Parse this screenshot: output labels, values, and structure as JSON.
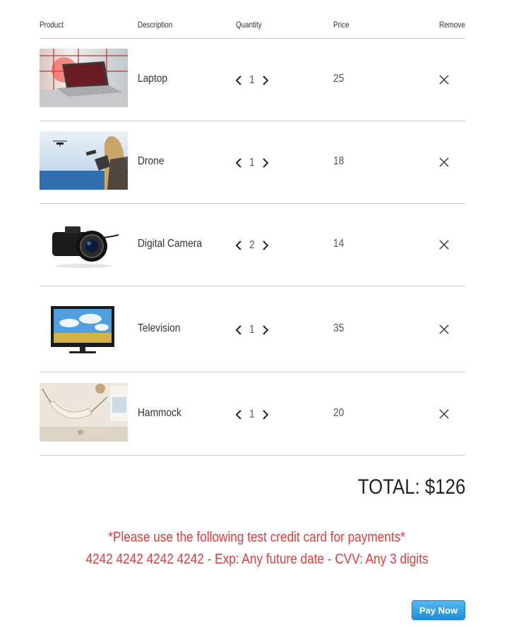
{
  "header": {
    "product": "Product",
    "description": "Description",
    "quantity": "Quantity",
    "price": "Price",
    "remove": "Remove"
  },
  "items": [
    {
      "name": "Laptop",
      "quantity": "1",
      "price": "25",
      "image": "laptop-photo"
    },
    {
      "name": "Drone",
      "quantity": "1",
      "price": "18",
      "image": "drone-photo"
    },
    {
      "name": "Digital Camera",
      "quantity": "2",
      "price": "14",
      "image": "camera-photo"
    },
    {
      "name": "Television",
      "quantity": "1",
      "price": "35",
      "image": "television-photo"
    },
    {
      "name": "Hammock",
      "quantity": "1",
      "price": "20",
      "image": "hammock-photo"
    }
  ],
  "total": "TOTAL: $126",
  "notice": {
    "line1": "*Please use the following test credit card for payments*",
    "line2": "4242 4242 4242 4242 - Exp: Any future date - CVV: Any 3 digits"
  },
  "pay_button": "Pay Now",
  "icons": {
    "decrement": "chevron-left-icon",
    "increment": "chevron-right-icon",
    "remove": "close-icon"
  },
  "colors": {
    "notice": "#e23b3b",
    "button": "#1d8fdc",
    "divider": "#c8c8c8"
  }
}
